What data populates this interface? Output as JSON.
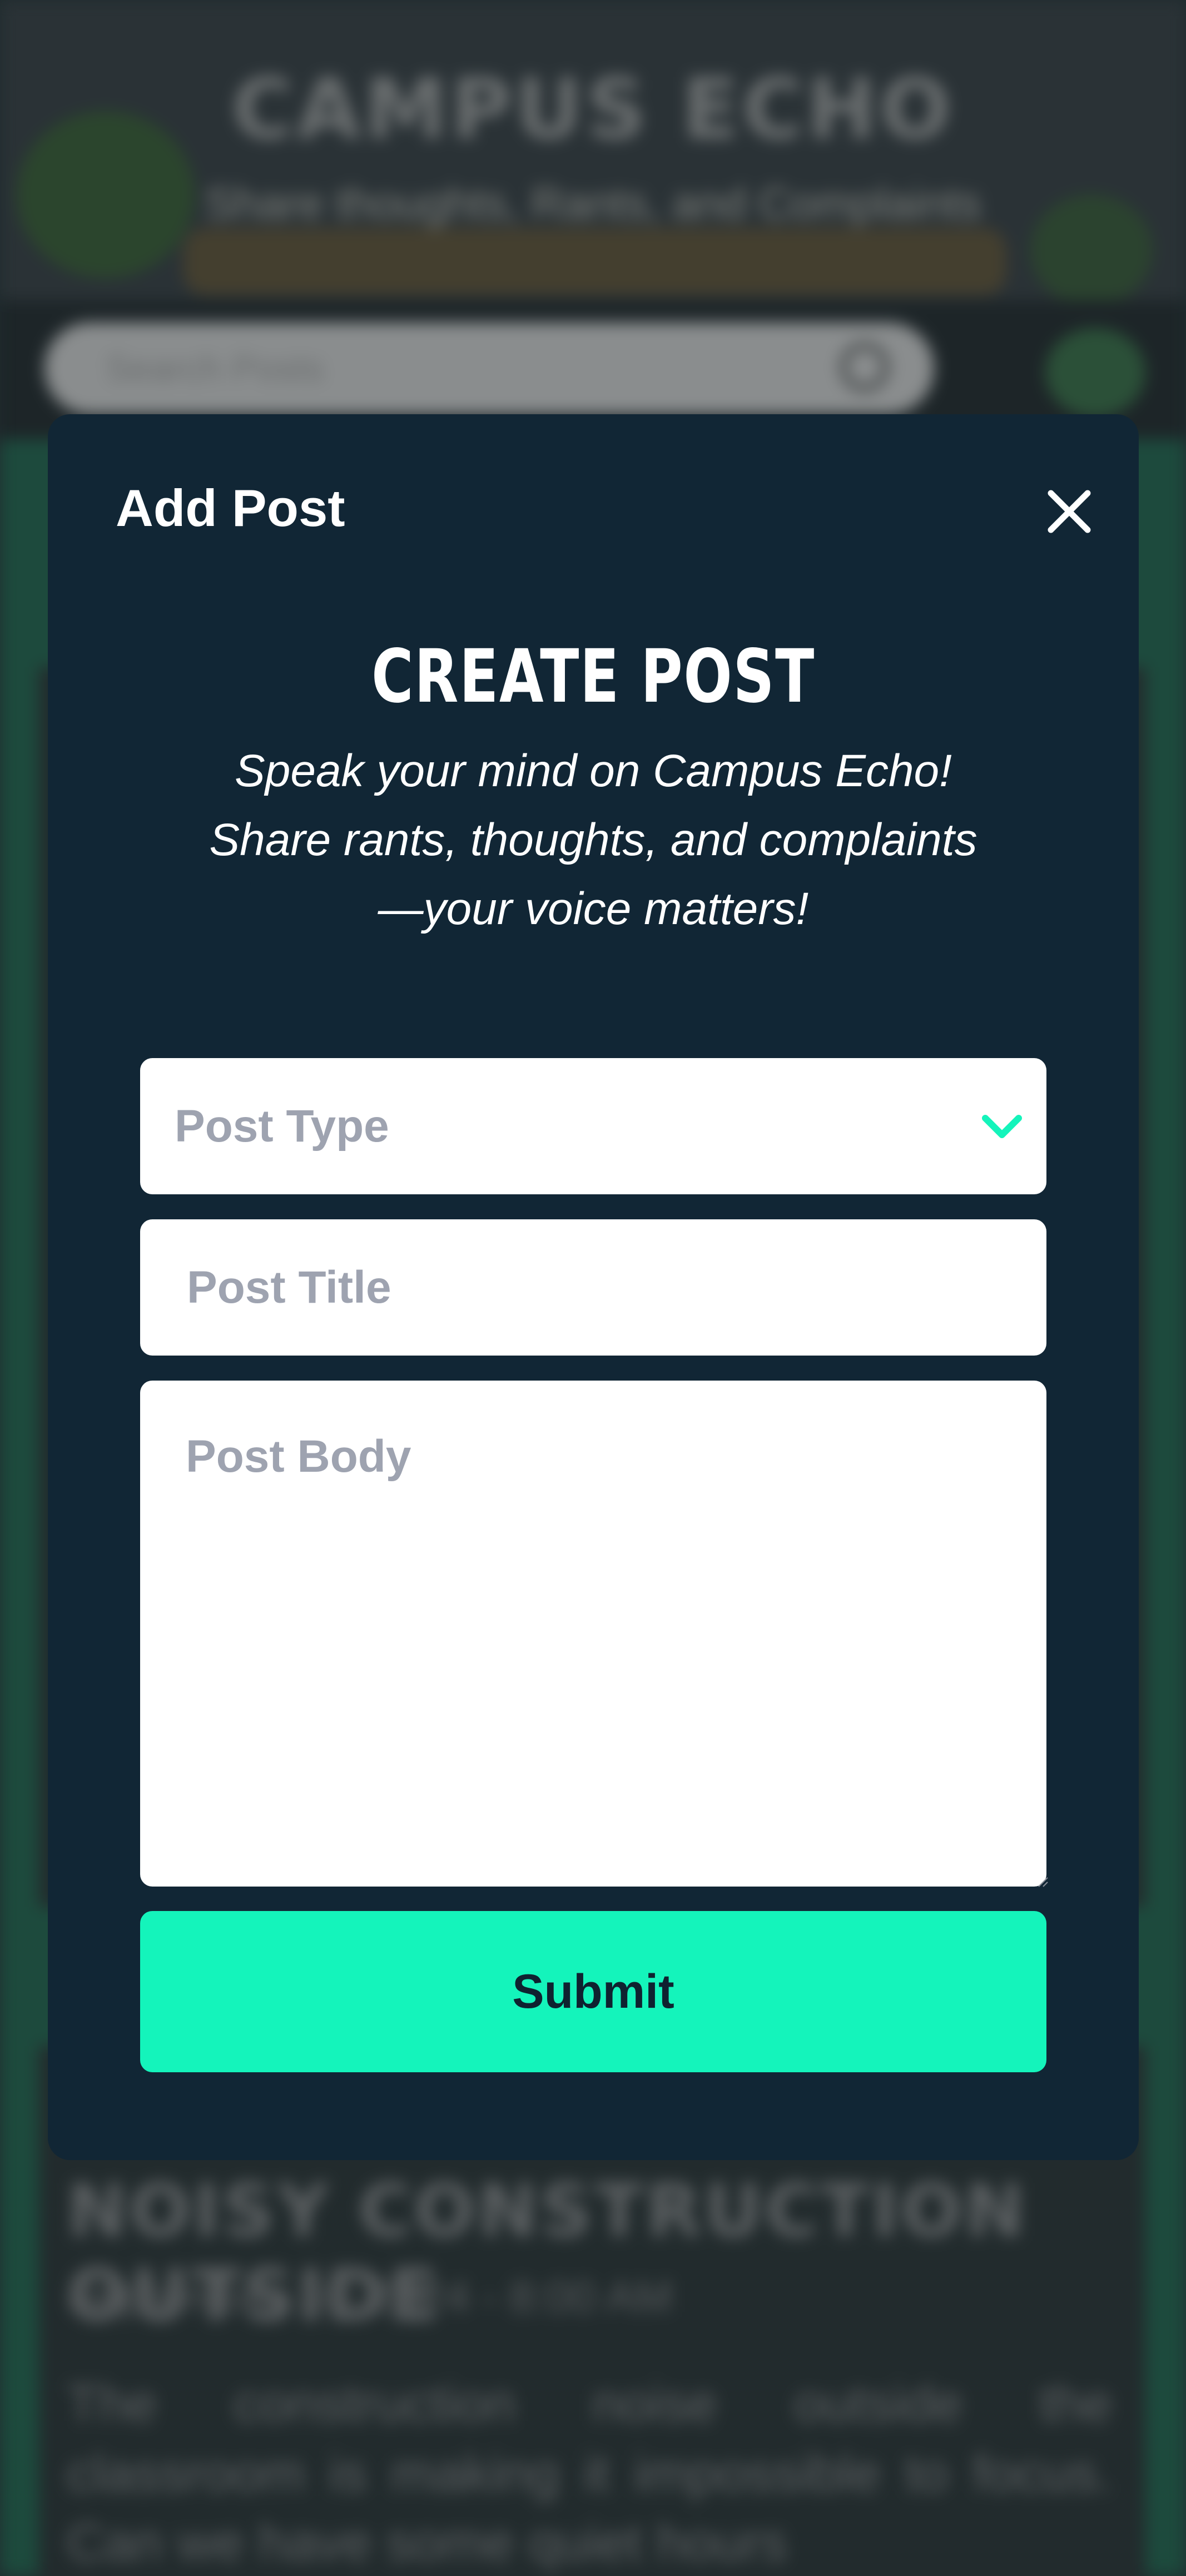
{
  "background": {
    "site_title": "CAMPUS ECHO",
    "site_tagline": "Share thoughts, Rants, and Complaints",
    "search_placeholder": "Search Posts",
    "card": {
      "title": "NOISY CONSTRUCTION OUTSIDE",
      "date": "September 16, 2024 - 8:00 AM",
      "body": "The construction noise outside the classroom is making it impossible to focus. Can we have some quiet hours"
    }
  },
  "modal": {
    "header_title": "Add Post",
    "heading": "CREATE POST",
    "intro_lines": [
      "Speak your mind on Campus Echo!",
      "Share rants, thoughts, and complaints",
      "—your voice matters!"
    ],
    "post_type_placeholder": "Post Type",
    "post_title_placeholder": "Post Title",
    "post_body_placeholder": "Post Body",
    "submit_label": "Submit"
  },
  "colors": {
    "modal_bg": "#112635",
    "accent": "#14f4bb",
    "page_bg": "#1d4a3d"
  },
  "icons": {
    "close": "close-icon",
    "dropdown": "chevron-down-icon",
    "search": "search-icon"
  }
}
